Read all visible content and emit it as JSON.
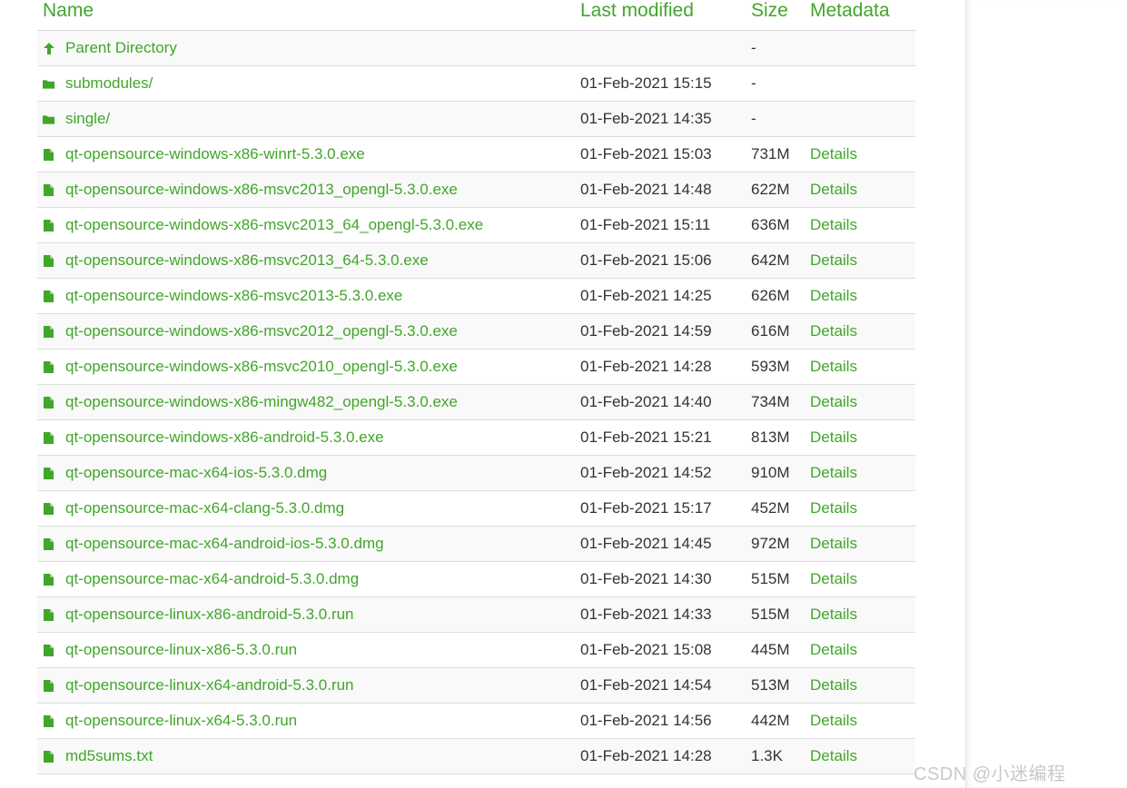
{
  "header": {
    "name": "Name",
    "last_modified": "Last modified",
    "size": "Size",
    "metadata": "Metadata"
  },
  "rows": [
    {
      "kind": "parent",
      "icon": "arrow-up-icon",
      "name": "Parent Directory",
      "modified": "",
      "size": "-",
      "meta": ""
    },
    {
      "kind": "folder",
      "icon": "folder-icon",
      "name": "submodules/",
      "modified": "01-Feb-2021 15:15",
      "size": "-",
      "meta": ""
    },
    {
      "kind": "folder",
      "icon": "folder-icon",
      "name": "single/",
      "modified": "01-Feb-2021 14:35",
      "size": "-",
      "meta": ""
    },
    {
      "kind": "file",
      "icon": "file-icon",
      "name": "qt-opensource-windows-x86-winrt-5.3.0.exe",
      "modified": "01-Feb-2021 15:03",
      "size": "731M",
      "meta": "Details"
    },
    {
      "kind": "file",
      "icon": "file-icon",
      "name": "qt-opensource-windows-x86-msvc2013_opengl-5.3.0.exe",
      "modified": "01-Feb-2021 14:48",
      "size": "622M",
      "meta": "Details"
    },
    {
      "kind": "file",
      "icon": "file-icon",
      "name": "qt-opensource-windows-x86-msvc2013_64_opengl-5.3.0.exe",
      "modified": "01-Feb-2021 15:11",
      "size": "636M",
      "meta": "Details"
    },
    {
      "kind": "file",
      "icon": "file-icon",
      "name": "qt-opensource-windows-x86-msvc2013_64-5.3.0.exe",
      "modified": "01-Feb-2021 15:06",
      "size": "642M",
      "meta": "Details"
    },
    {
      "kind": "file",
      "icon": "file-icon",
      "name": "qt-opensource-windows-x86-msvc2013-5.3.0.exe",
      "modified": "01-Feb-2021 14:25",
      "size": "626M",
      "meta": "Details"
    },
    {
      "kind": "file",
      "icon": "file-icon",
      "name": "qt-opensource-windows-x86-msvc2012_opengl-5.3.0.exe",
      "modified": "01-Feb-2021 14:59",
      "size": "616M",
      "meta": "Details"
    },
    {
      "kind": "file",
      "icon": "file-icon",
      "name": "qt-opensource-windows-x86-msvc2010_opengl-5.3.0.exe",
      "modified": "01-Feb-2021 14:28",
      "size": "593M",
      "meta": "Details"
    },
    {
      "kind": "file",
      "icon": "file-icon",
      "name": "qt-opensource-windows-x86-mingw482_opengl-5.3.0.exe",
      "modified": "01-Feb-2021 14:40",
      "size": "734M",
      "meta": "Details"
    },
    {
      "kind": "file",
      "icon": "file-icon",
      "name": "qt-opensource-windows-x86-android-5.3.0.exe",
      "modified": "01-Feb-2021 15:21",
      "size": "813M",
      "meta": "Details"
    },
    {
      "kind": "file",
      "icon": "file-icon",
      "name": "qt-opensource-mac-x64-ios-5.3.0.dmg",
      "modified": "01-Feb-2021 14:52",
      "size": "910M",
      "meta": "Details"
    },
    {
      "kind": "file",
      "icon": "file-icon",
      "name": "qt-opensource-mac-x64-clang-5.3.0.dmg",
      "modified": "01-Feb-2021 15:17",
      "size": "452M",
      "meta": "Details"
    },
    {
      "kind": "file",
      "icon": "file-icon",
      "name": "qt-opensource-mac-x64-android-ios-5.3.0.dmg",
      "modified": "01-Feb-2021 14:45",
      "size": "972M",
      "meta": "Details"
    },
    {
      "kind": "file",
      "icon": "file-icon",
      "name": "qt-opensource-mac-x64-android-5.3.0.dmg",
      "modified": "01-Feb-2021 14:30",
      "size": "515M",
      "meta": "Details"
    },
    {
      "kind": "file",
      "icon": "file-icon",
      "name": "qt-opensource-linux-x86-android-5.3.0.run",
      "modified": "01-Feb-2021 14:33",
      "size": "515M",
      "meta": "Details"
    },
    {
      "kind": "file",
      "icon": "file-icon",
      "name": "qt-opensource-linux-x86-5.3.0.run",
      "modified": "01-Feb-2021 15:08",
      "size": "445M",
      "meta": "Details"
    },
    {
      "kind": "file",
      "icon": "file-icon",
      "name": "qt-opensource-linux-x64-android-5.3.0.run",
      "modified": "01-Feb-2021 14:54",
      "size": "513M",
      "meta": "Details"
    },
    {
      "kind": "file",
      "icon": "file-icon",
      "name": "qt-opensource-linux-x64-5.3.0.run",
      "modified": "01-Feb-2021 14:56",
      "size": "442M",
      "meta": "Details"
    },
    {
      "kind": "file",
      "icon": "file-icon",
      "name": "md5sums.txt",
      "modified": "01-Feb-2021 14:28",
      "size": "1.3K",
      "meta": "Details"
    }
  ],
  "watermark": "CSDN @小迷编程",
  "colors": {
    "accent": "#41a62a",
    "text": "#333333",
    "row_stripe": "#f9f9f9",
    "border": "#dddddd"
  }
}
